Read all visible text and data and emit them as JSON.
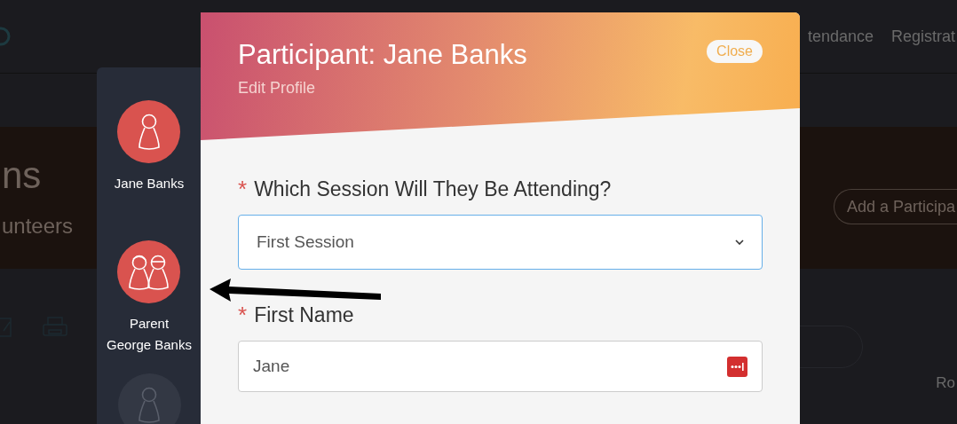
{
  "backdrop": {
    "nav_links": [
      "tendance",
      "Registrat"
    ],
    "banner_title": "ns",
    "banner_subtitle": "unteers",
    "add_button": "Add a Participa",
    "corner_text": "Ro"
  },
  "people": [
    {
      "kind": "single",
      "selected": true,
      "name_lines": [
        "Jane Banks"
      ]
    },
    {
      "kind": "pair",
      "selected": true,
      "name_lines": [
        "Parent",
        "George Banks"
      ]
    },
    {
      "kind": "single",
      "selected": false
    }
  ],
  "modal": {
    "title": "Participant: Jane Banks",
    "subtitle": "Edit Profile",
    "close_button": "Close",
    "fields": [
      {
        "kind": "select",
        "marker": "*",
        "label": "Which Session Will They Be Attending?",
        "value": "First Session",
        "focused": true
      },
      {
        "kind": "text",
        "marker": "*",
        "label": "First Name",
        "value": "Jane",
        "focused": false
      }
    ]
  }
}
